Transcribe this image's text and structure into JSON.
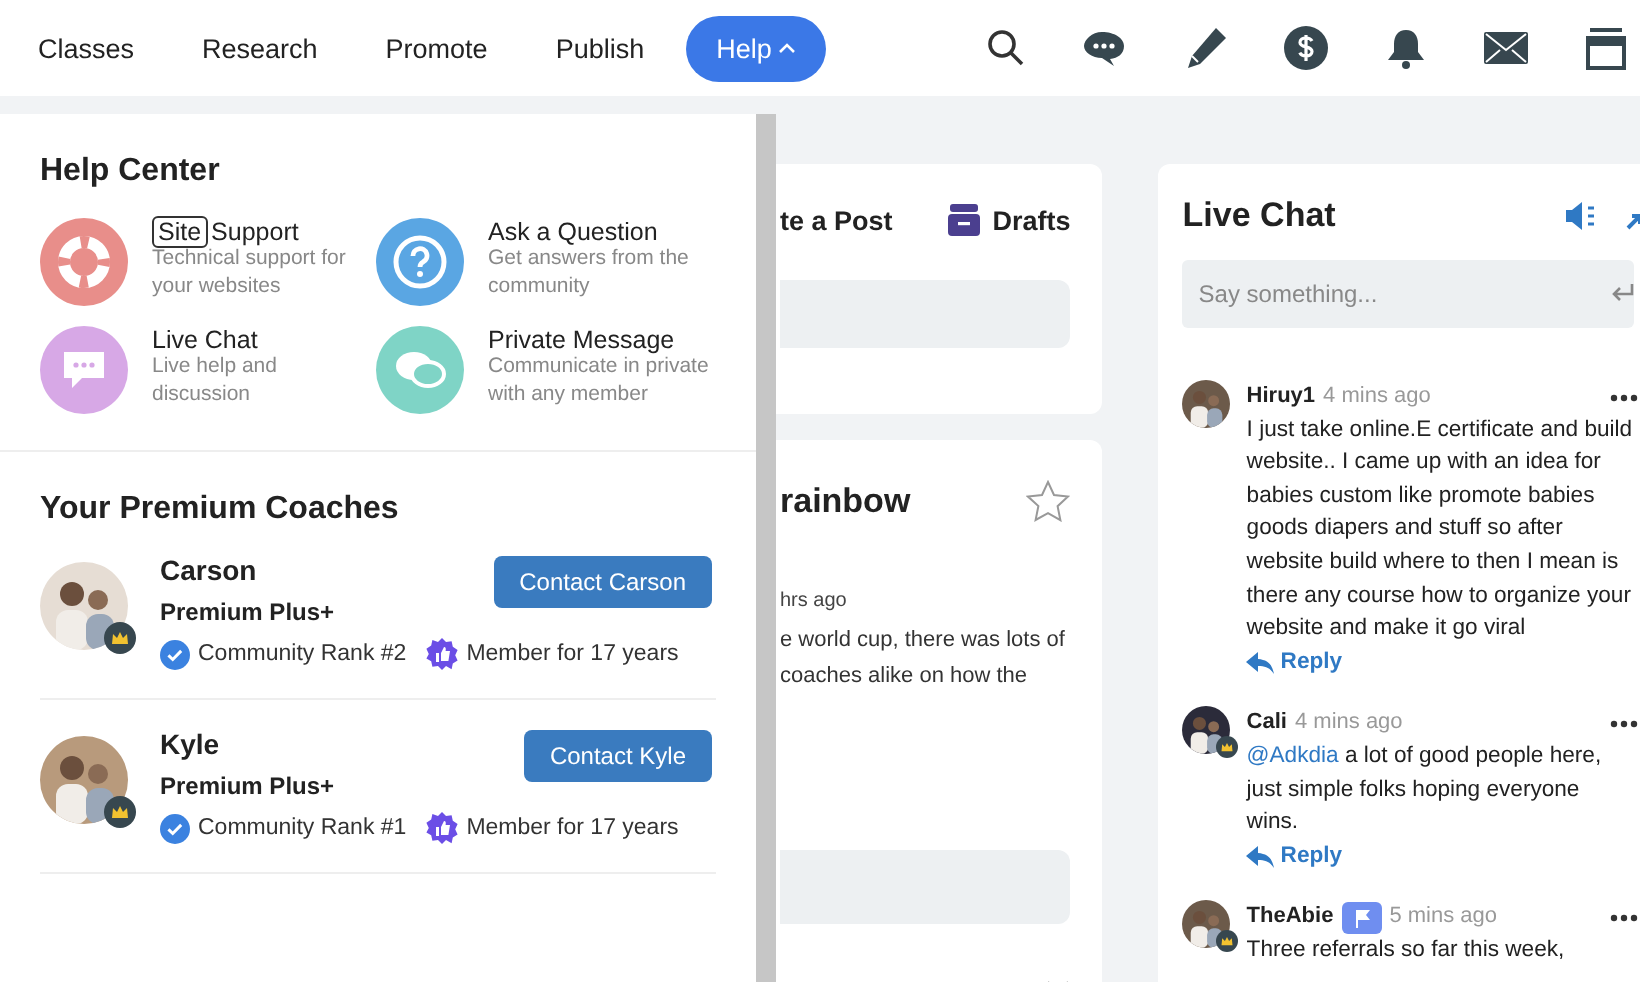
{
  "nav": {
    "items": [
      {
        "label": "Classes",
        "selected": false
      },
      {
        "label": "Research",
        "selected": false
      },
      {
        "label": "Promote",
        "selected": false
      },
      {
        "label": "Publish",
        "selected": false
      },
      {
        "label": "Help",
        "selected": true
      }
    ]
  },
  "help_center": {
    "title": "Help Center",
    "items": [
      {
        "kind": "support",
        "tag": "Site",
        "title": "Support",
        "description": "Technical support for your websites",
        "color": "#e88e8a"
      },
      {
        "kind": "question",
        "title": "Ask a Question",
        "description": "Get answers from the community",
        "color": "#5aa6e3"
      },
      {
        "kind": "chat",
        "title": "Live Chat",
        "description": "Live help and discussion",
        "color": "#d7a8e6"
      },
      {
        "kind": "message",
        "title": "Private Message",
        "description": "Communicate in private with any member",
        "color": "#7fd4c6"
      }
    ]
  },
  "coaches": {
    "title": "Your Premium Coaches",
    "items": [
      {
        "name": "Carson",
        "plan": "Premium Plus+",
        "button": "Contact Carson",
        "rank": "Community Rank #2",
        "membership": "Member for 17 years"
      },
      {
        "name": "Kyle",
        "plan": "Premium Plus+",
        "button": "Contact Kyle",
        "rank": "Community Rank #1",
        "membership": "Member for 17 years"
      }
    ]
  },
  "post_box": {
    "create": "te a Post",
    "drafts": "Drafts"
  },
  "post": {
    "title": "rainbow",
    "time": "hrs ago",
    "lines": [
      "e world cup, there was lots of",
      "coaches alike on how the"
    ],
    "starred": false
  },
  "live_chat": {
    "title": "Live Chat",
    "placeholder": "Say something...",
    "messages": [
      {
        "user": "Hiruy1",
        "time": "4 mins ago",
        "text": "I just take online.E certificate and build website.. I came up with an idea for babies custom like promote babies goods diapers and stuff so after website build where to then I mean is there any course how to organize your website and make it go viral",
        "reply": "Reply",
        "crown": false,
        "flag": false
      },
      {
        "user": "Cali",
        "time": "4 mins ago",
        "mention": "@Adkdia",
        "text": " a lot of good people here, just simple folks hoping everyone wins.",
        "reply": "Reply",
        "crown": true,
        "flag": false
      },
      {
        "user": "TheAbie",
        "time": "5 mins ago",
        "text": "Three referrals so far this week,",
        "crown": true,
        "flag": true
      }
    ]
  }
}
